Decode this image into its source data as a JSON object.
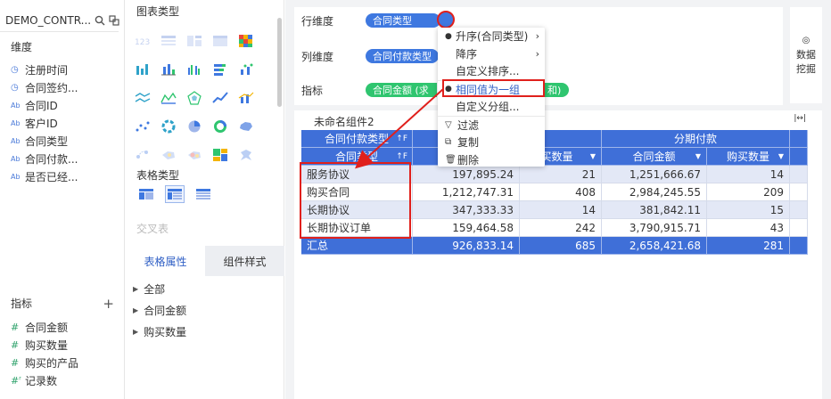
{
  "datasource": {
    "name": "DEMO_CONTR..."
  },
  "dimensions": {
    "title": "维度",
    "items": [
      {
        "type": "clock",
        "label": "注册时间"
      },
      {
        "type": "clock",
        "label": "合同签约..."
      },
      {
        "type": "Ab",
        "label": "合同ID"
      },
      {
        "type": "Ab",
        "label": "客户ID"
      },
      {
        "type": "Ab",
        "label": "合同类型"
      },
      {
        "type": "Ab",
        "label": "合同付款..."
      },
      {
        "type": "Ab",
        "label": "是否已经..."
      }
    ]
  },
  "indicators": {
    "title": "指标",
    "add": "+",
    "items": [
      {
        "type": "#",
        "label": "合同金额"
      },
      {
        "type": "#",
        "label": "购买数量"
      },
      {
        "type": "#",
        "label": "购买的产品"
      },
      {
        "type": "#",
        "label": "记录数"
      }
    ]
  },
  "chart_panel": {
    "chart_type_title": "图表类型",
    "table_type_title": "表格类型",
    "cross_table": "交叉表",
    "tabs": [
      "表格属性",
      "组件样式"
    ],
    "props": [
      "全部",
      "合同金额",
      "购买数量"
    ]
  },
  "zones": {
    "row_label": "行维度",
    "row_pill": "合同类型",
    "col_label": "列维度",
    "col_pill": "合同付款类型",
    "ind_label": "指标",
    "ind_pill": "合同金额 (求",
    "ind_pill_tail": "和)"
  },
  "mining": {
    "icon": "◎",
    "line1": "数据",
    "line2": "挖掘"
  },
  "widget": {
    "title": "未命名组件2",
    "expand": "|↔|"
  },
  "context_menu": {
    "items": [
      {
        "label": "升序(合同类型)",
        "dot": true,
        "sub": true
      },
      {
        "label": "降序",
        "sub": true
      },
      {
        "label": "自定义排序..."
      },
      {
        "label": "相同值为一组",
        "dot": true,
        "highlight": true
      },
      {
        "label": "自定义分组..."
      },
      {
        "label": "过滤",
        "glyph": "filter"
      },
      {
        "label": "复制",
        "glyph": "copy"
      },
      {
        "label": "删除",
        "glyph": "trash"
      }
    ]
  },
  "table": {
    "header1": {
      "col": "合同付款类型",
      "group2": "分期付款"
    },
    "header2": {
      "row": "合同类型",
      "m1": "购买数量",
      "m2": "合同金额",
      "m3": "购买数量"
    },
    "rows": [
      {
        "name": "服务协议",
        "v1": "197,895.24",
        "v2": "21",
        "v3": "1,251,666.67",
        "v4": "14"
      },
      {
        "name": "购买合同",
        "v1": "1,212,747.31",
        "v2": "408",
        "v3": "2,984,245.55",
        "v4": "209"
      },
      {
        "name": "长期协议",
        "v1": "347,333.33",
        "v2": "14",
        "v3": "381,842.11",
        "v4": "15"
      },
      {
        "name": "长期协议订单",
        "v1": "159,464.58",
        "v2": "242",
        "v3": "3,790,915.71",
        "v4": "43"
      }
    ],
    "total": {
      "name": "汇总",
      "v1": "926,833.14",
      "v2": "685",
      "v3": "2,658,421.68",
      "v4": "281"
    }
  }
}
